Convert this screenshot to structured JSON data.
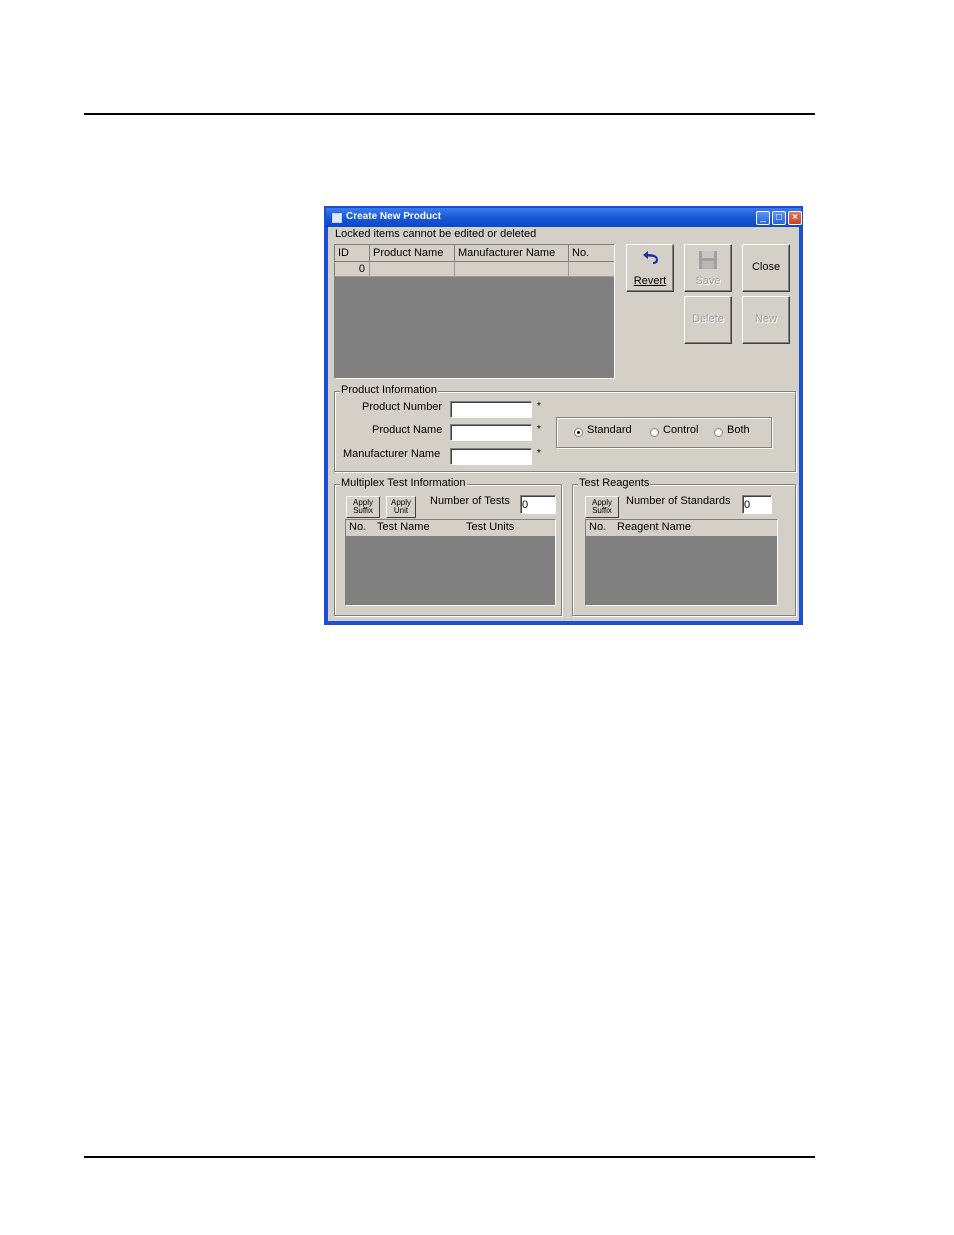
{
  "window": {
    "title": "Create New Product",
    "note": "Locked items cannot be edited or deleted"
  },
  "products_grid": {
    "columns": [
      "ID",
      "Product Name",
      "Manufacturer Name",
      "No."
    ],
    "rows": [
      [
        "0",
        "",
        "",
        ""
      ]
    ]
  },
  "toolbar": {
    "revert_label": "Revert",
    "save_label": "Save",
    "close_label": "Close",
    "delete_label": "Delete",
    "new_label": "New"
  },
  "product_info": {
    "legend": "Product Information",
    "product_number_label": "Product Number",
    "product_number_value": "",
    "product_name_label": "Product Name",
    "product_name_value": "",
    "manufacturer_name_label": "Manufacturer Name",
    "manufacturer_name_value": "",
    "required_mark": "*",
    "type_options": [
      "Standard",
      "Control",
      "Both"
    ],
    "type_selected": "Standard"
  },
  "multiplex": {
    "legend": "Multiplex Test Information",
    "apply_suffix_label": [
      "Apply",
      "Suffix"
    ],
    "apply_unit_label": [
      "Apply",
      "Unit"
    ],
    "number_of_tests_label": "Number of Tests",
    "number_of_tests_value": "0",
    "columns": [
      "No.",
      "Test Name",
      "Test Units"
    ]
  },
  "reagents": {
    "legend": "Test Reagents",
    "apply_suffix_label": [
      "Apply",
      "Suffix"
    ],
    "number_of_standards_label": "Number of Standards",
    "number_of_standards_value": "0",
    "columns": [
      "No.",
      "Reagent Name"
    ]
  }
}
